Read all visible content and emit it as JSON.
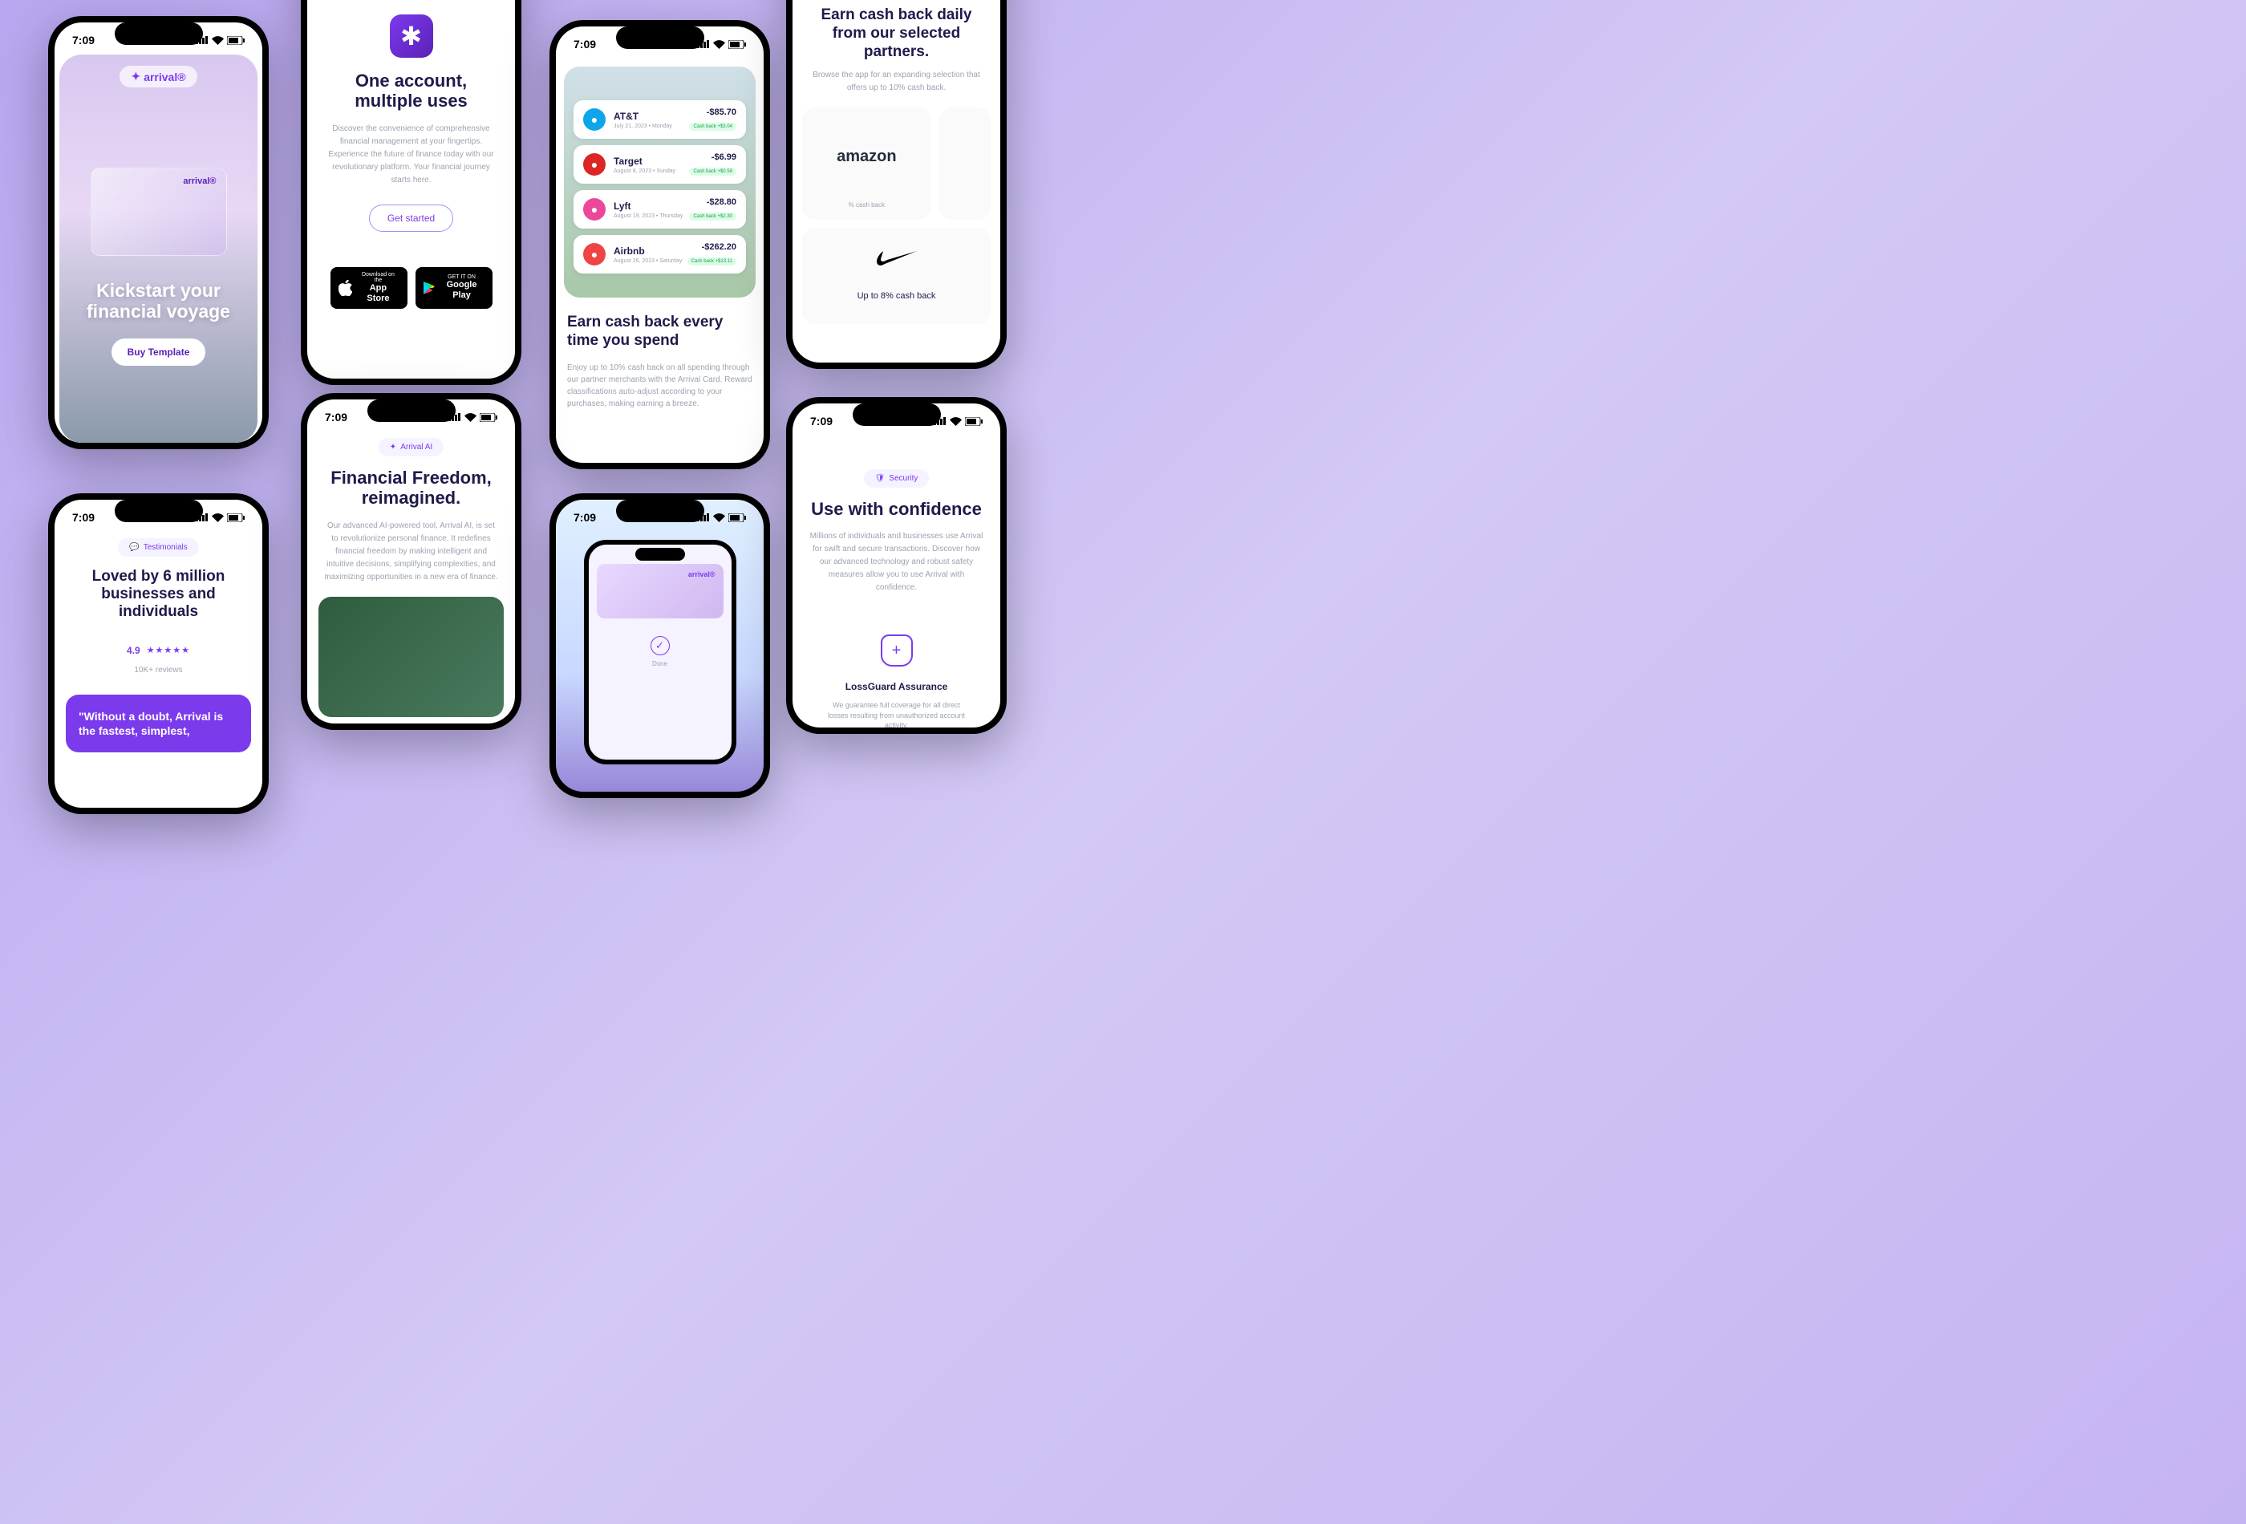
{
  "status_time": "7:09",
  "brand": "arrival®",
  "p1": {
    "title_l1": "Kickstart your",
    "title_l2": "financial voyage",
    "cta": "Buy Template"
  },
  "p2": {
    "title_l1": "One account,",
    "title_l2": "multiple uses",
    "body": "Discover the convenience of comprehensive financial management at your fingertips. Experience the future of finance today with our revolutionary platform. Your financial journey starts here.",
    "cta": "Get started",
    "appstore_sm": "Download on the",
    "appstore_lg": "App Store",
    "gplay_sm": "GET IT ON",
    "gplay_lg": "Google Play"
  },
  "p3": {
    "tx": [
      {
        "name": "AT&T",
        "date": "July 21, 2023 • Monday",
        "amount": "-$85.70",
        "cashback": "Cash back +$3.04",
        "color": "#0ea5e9"
      },
      {
        "name": "Target",
        "date": "August 8, 2023 • Sunday",
        "amount": "-$6.99",
        "cashback": "Cash back +$0.58",
        "color": "#dc2626"
      },
      {
        "name": "Lyft",
        "date": "August 19, 2023 • Thursday",
        "amount": "-$28.80",
        "cashback": "Cash back +$2.30",
        "color": "#ec4899"
      },
      {
        "name": "Airbnb",
        "date": "August 26, 2023 • Saturday",
        "amount": "-$262.20",
        "cashback": "Cash back +$13.11",
        "color": "#ef4444"
      }
    ],
    "title": "Earn cash back every time you spend",
    "body": "Enjoy up to 10% cash back on all spending through our partner merchants with the Arrival Card. Reward classifications auto-adjust according to your purchases, making earning a breeze."
  },
  "p4": {
    "title": "Earn cash back daily from our selected partners.",
    "body": "Browse the app for an expanding selection that offers up to 10% cash back.",
    "amazon": "amazon",
    "amazon_sub": "% cash back",
    "nike_sub": "Up to 8% cash back"
  },
  "p5": {
    "tag": "Testimonials",
    "title": "Loved by 6 million businesses and individuals",
    "rating": "4.9",
    "reviews": "10K+ reviews",
    "quote": "\"Without a doubt, Arrival is the fastest, simplest,"
  },
  "p6": {
    "tag": "Arrival AI",
    "title_l1": "Financial Freedom,",
    "title_l2": "reimagined.",
    "body": "Our advanced AI-powered tool, Arrival AI, is set to revolutionize personal finance. It redefines financial freedom by making intelligent and intuitive decisions, simplifying complexities, and maximizing opportunities in a new era of finance."
  },
  "p7": {
    "done": "Done",
    "brand": "arrival®"
  },
  "p8": {
    "tag": "Security",
    "title": "Use with confidence",
    "body": "Millions of individuals and businesses use Arrival for swift and secure transactions. Discover how our advanced technology and robust safety measures allow you to use Arrival with confidence.",
    "feat_title": "LossGuard Assurance",
    "feat_body": "We guarantee full coverage for all direct losses resulting from unauthorized account activity."
  }
}
